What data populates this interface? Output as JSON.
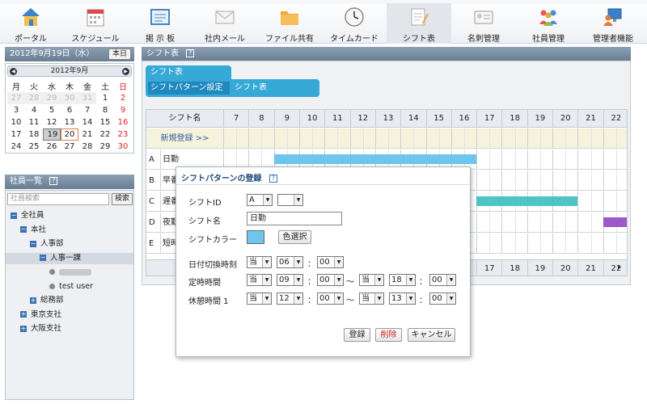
{
  "nav": {
    "items": [
      {
        "label": "ポータル",
        "icon": "house-icon",
        "active": false
      },
      {
        "label": "スケジュール",
        "icon": "calendar-icon",
        "active": false
      },
      {
        "label": "掲 示 板",
        "icon": "bulletin-board-icon",
        "active": false
      },
      {
        "label": "社内メール",
        "icon": "mail-icon",
        "active": false
      },
      {
        "label": "ファイル共有",
        "icon": "folder-icon",
        "active": false
      },
      {
        "label": "タイムカード",
        "icon": "clock-icon",
        "active": false
      },
      {
        "label": "シフト表",
        "icon": "shift-sheet-icon",
        "active": true
      },
      {
        "label": "名刺管理",
        "icon": "business-card-icon",
        "active": false
      },
      {
        "label": "社員管理",
        "icon": "employees-icon",
        "active": false
      },
      {
        "label": "管理者機能",
        "icon": "admin-icon",
        "active": false
      }
    ]
  },
  "calendar": {
    "date_heading": "2012年9月19日（水）",
    "today_label": "本日",
    "month_label": "2012年9月",
    "weekdays": [
      "月",
      "火",
      "水",
      "木",
      "金",
      "土",
      "日"
    ],
    "weeks": [
      [
        "27",
        "28",
        "29",
        "30",
        "31",
        "1",
        "2"
      ],
      [
        "3",
        "4",
        "5",
        "6",
        "7",
        "8",
        "9"
      ],
      [
        "10",
        "11",
        "12",
        "13",
        "14",
        "15",
        "16"
      ],
      [
        "17",
        "18",
        "19",
        "20",
        "21",
        "22",
        "23"
      ],
      [
        "24",
        "25",
        "26",
        "27",
        "28",
        "29",
        "30"
      ]
    ]
  },
  "employees": {
    "title": "社員一覧",
    "search_placeholder": "社員検索",
    "search_button": "検索",
    "tree": [
      {
        "label": "全社員",
        "indent": 0,
        "mark": "minus"
      },
      {
        "label": "本社",
        "indent": 1,
        "mark": "minus"
      },
      {
        "label": "人事部",
        "indent": 2,
        "mark": "minus"
      },
      {
        "label": "人事一課",
        "indent": 3,
        "mark": "minus",
        "highlight": true
      },
      {
        "label": "",
        "indent": 4,
        "mark": "dot",
        "blurred": true
      },
      {
        "label": "test user",
        "indent": 4,
        "mark": "dot"
      },
      {
        "label": "総務部",
        "indent": 2,
        "mark": "plus"
      },
      {
        "label": "東京支社",
        "indent": 1,
        "mark": "plus"
      },
      {
        "label": "大阪支社",
        "indent": 1,
        "mark": "plus"
      }
    ]
  },
  "main": {
    "title": "シフト表",
    "tab_top": "シフト表",
    "tab_active": "シフトパターン設定",
    "tab_other": "シフト表"
  },
  "grid": {
    "name_header": "シフト名",
    "hours": [
      "7",
      "8",
      "9",
      "10",
      "11",
      "12",
      "13",
      "14",
      "15",
      "16",
      "17",
      "18",
      "19",
      "20",
      "21",
      "22"
    ],
    "new_row_label": "新規登録 >>",
    "rows": [
      {
        "id": "A",
        "name": "日勤"
      },
      {
        "id": "B",
        "name": "早番"
      },
      {
        "id": "C",
        "name": "遅番"
      },
      {
        "id": "D",
        "name": "夜勤"
      },
      {
        "id": "E",
        "name": "短時"
      }
    ]
  },
  "dialog": {
    "title": "シフトパターンの登録",
    "shift_id_label": "シフトID",
    "shift_id_value": "A",
    "shift_id_sub_value": "",
    "shift_name_label": "シフト名",
    "shift_name_value": "日勤",
    "shift_color_label": "シフトカラー",
    "shift_color_value": "#6ec6ee",
    "color_select_button": "色選択",
    "day_switch_label": "日付切換時刻",
    "day_switch": {
      "day": "当",
      "hour": "06",
      "minute": "00"
    },
    "fixed_time_label": "定時時間",
    "fixed_time": {
      "start_day": "当",
      "start_hour": "09",
      "start_minute": "00",
      "end_day": "当",
      "end_hour": "18",
      "end_minute": "00"
    },
    "break_time_label": "休憩時間 1",
    "break_time": {
      "start_day": "当",
      "start_hour": "12",
      "start_minute": "00",
      "end_day": "当",
      "end_hour": "13",
      "end_minute": "00"
    },
    "colon": "：",
    "tilde": "〜",
    "register_button": "登録",
    "delete_button": "削除",
    "cancel_button": "キャンセル"
  },
  "colors": {
    "nav_active_bg": "#e2e6ea",
    "panel_header": "#7b90a5",
    "tab_blue": "#37a9d6",
    "shift_day_blue": "#6ec6ee",
    "shift_late_teal": "#4fc4c4",
    "shift_night_purple": "#9b59c9",
    "sunday_red": "#dd2222",
    "delete_red": "#cc2222"
  }
}
